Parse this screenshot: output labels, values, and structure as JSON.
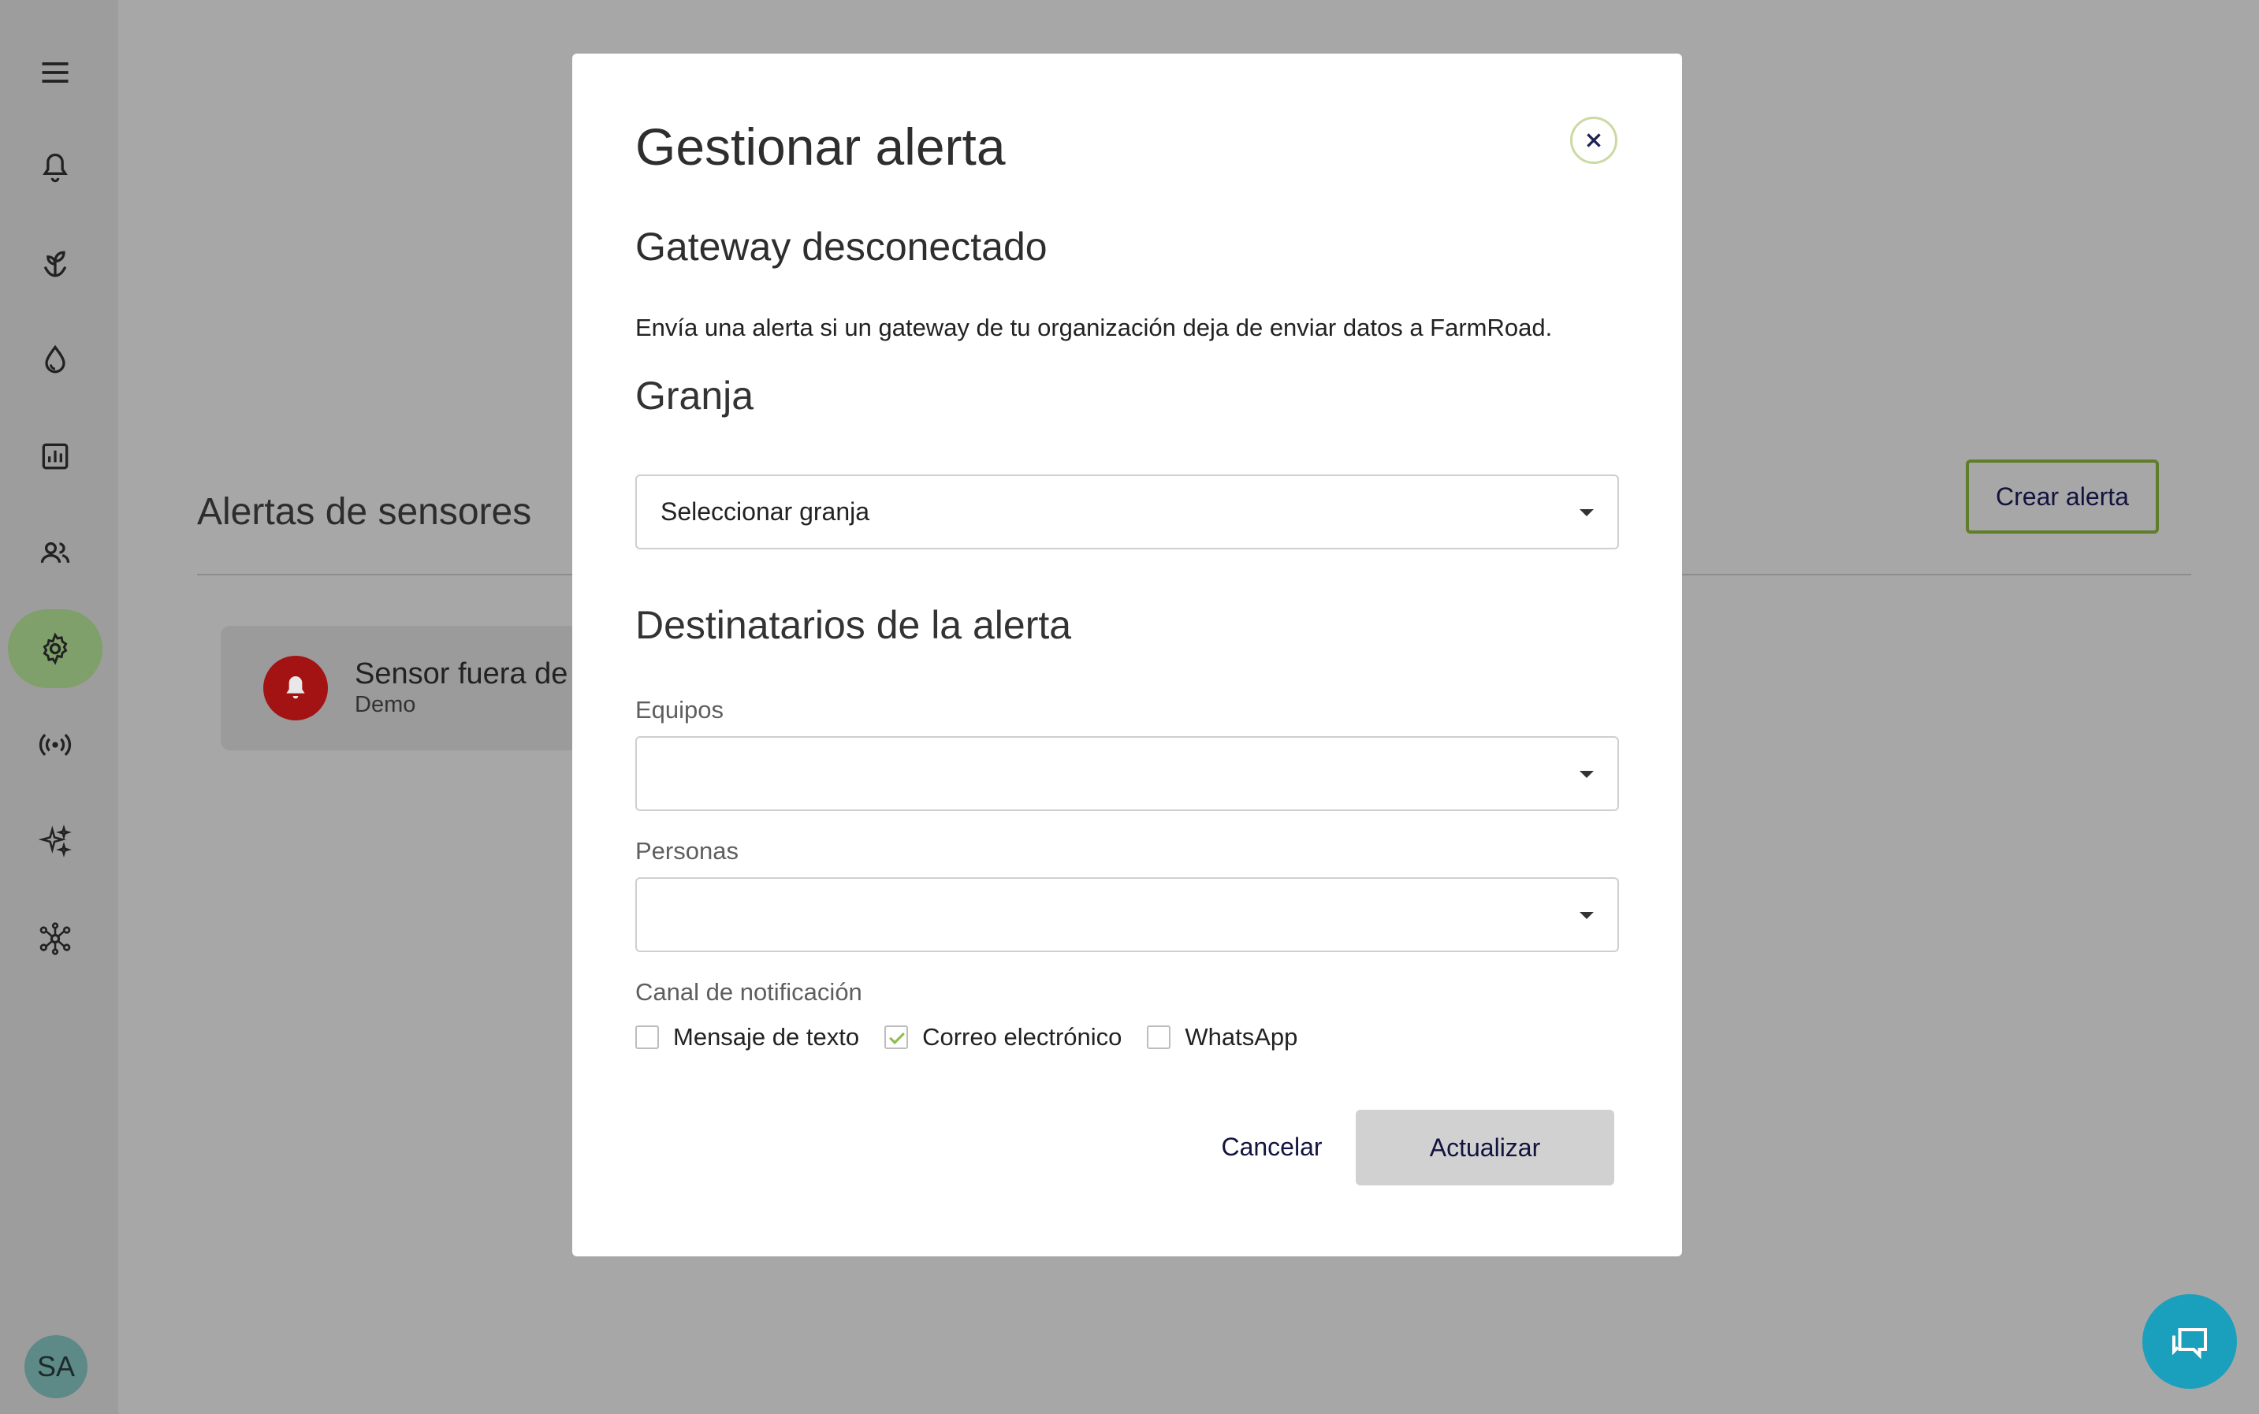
{
  "sidebar": {
    "items": [
      {
        "icon": "menu-icon"
      },
      {
        "icon": "bell-icon"
      },
      {
        "icon": "sprout-icon"
      },
      {
        "icon": "water-drop-icon"
      },
      {
        "icon": "bar-chart-icon"
      },
      {
        "icon": "people-icon"
      },
      {
        "icon": "gear-icon",
        "active": true
      },
      {
        "icon": "broadcast-icon"
      },
      {
        "icon": "sparkles-icon"
      },
      {
        "icon": "network-icon"
      }
    ],
    "avatar_initials": "SA"
  },
  "main": {
    "title": "Alertas de sensores",
    "create_button": "Crear alerta",
    "alert_card": {
      "title": "Sensor fuera de",
      "subtitle": "Demo"
    }
  },
  "modal": {
    "title": "Gestionar alerta",
    "alert_type": "Gateway desconectado",
    "description": "Envía una alerta si un gateway de tu organización deja de enviar datos a FarmRoad.",
    "farm_section": "Granja",
    "farm_select_value": "Seleccionar granja",
    "recipients_section": "Destinatarios de la alerta",
    "teams_label": "Equipos",
    "teams_value": "",
    "people_label": "Personas",
    "people_value": "",
    "channel_label": "Canal de notificación",
    "channels": [
      {
        "label": "Mensaje de texto",
        "checked": false
      },
      {
        "label": "Correo electrónico",
        "checked": true
      },
      {
        "label": "WhatsApp",
        "checked": false
      }
    ],
    "cancel_button": "Cancelar",
    "update_button": "Actualizar"
  },
  "colors": {
    "overlay": "#a7a7a7",
    "active_nav": "#7fa06a",
    "alert_red": "#a41313",
    "chat_fab": "#1aa0bc",
    "check_green": "#8dbb48",
    "button_text": "#12133f"
  }
}
